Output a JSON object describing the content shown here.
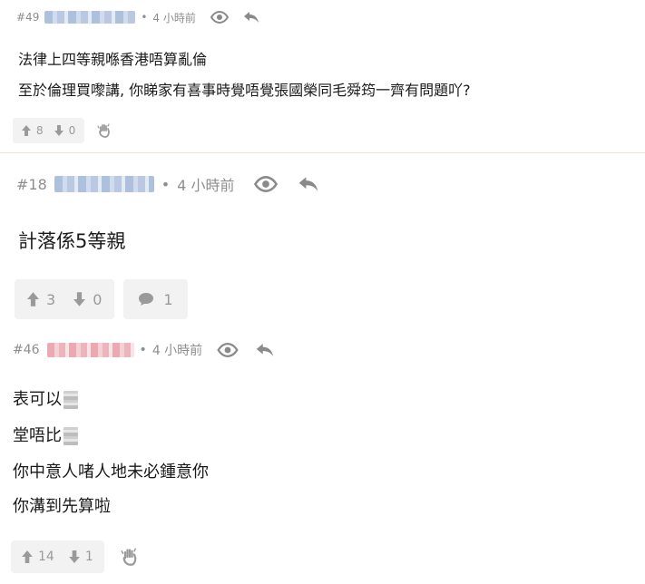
{
  "posts": [
    {
      "number": "#49",
      "time": "4 小時前",
      "lines": [
        "法律上四等親喺香港唔算亂倫",
        "至於倫理買嚟講, 你睇家有喜事時覺唔覺張國榮同毛舜筠一齊有問題吖?"
      ],
      "upvotes": "8",
      "downvotes": "0"
    },
    {
      "number": "#18",
      "time": "4 小時前",
      "lines": [
        "計落係5等親"
      ],
      "upvotes": "3",
      "downvotes": "0",
      "replies": "1"
    },
    {
      "number": "#46",
      "time": "4 小時前",
      "lines": [
        "表可以",
        "堂唔比",
        "你中意人啫人地未必鍾意你",
        "你溝到先算啦"
      ],
      "upvotes": "14",
      "downvotes": "1"
    }
  ],
  "separator": "•",
  "icons": {
    "view": "eye-icon",
    "reply": "reply-arrow-icon",
    "upvote": "arrow-up-icon",
    "downvote": "arrow-down-icon",
    "hand": "hand-wave-icon",
    "comment": "speech-bubble-icon"
  },
  "colors": {
    "meta_gray": "#8e8e8e",
    "divider": "#f3e2c8",
    "pill_bg": "#f2f2f2"
  }
}
